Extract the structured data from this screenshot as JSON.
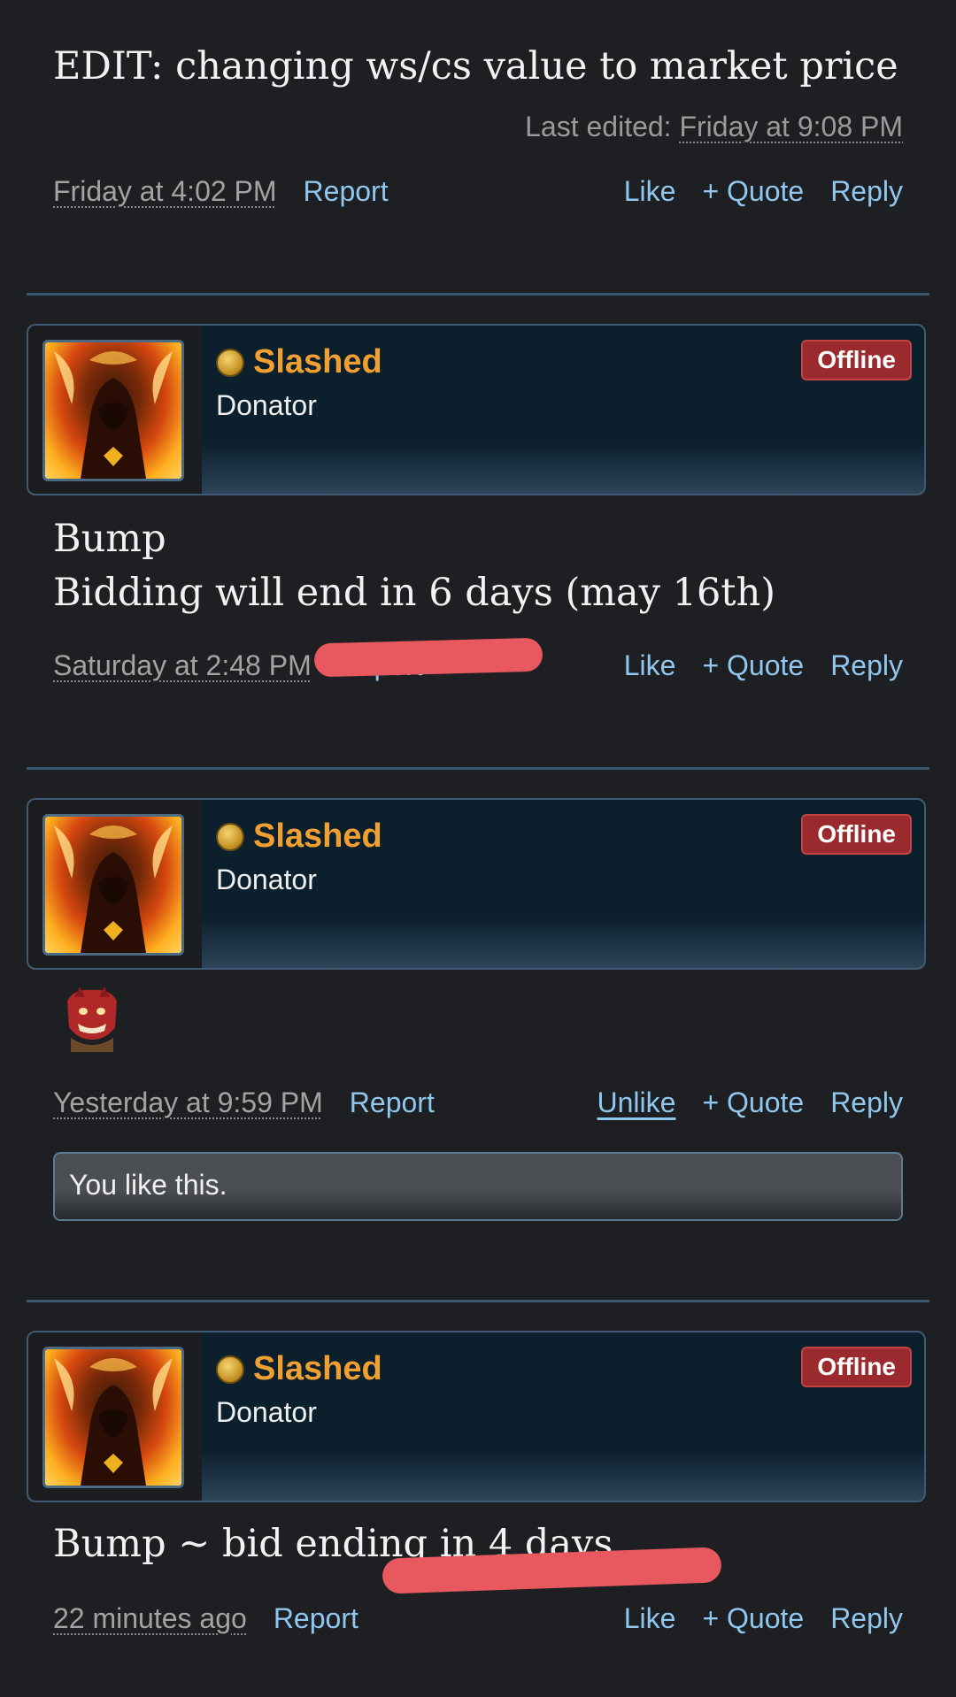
{
  "prev_post": {
    "text": "EDIT: changing ws/cs value to market price",
    "last_edited_label": "Last edited:",
    "last_edited_value": "Friday at 9:08 PM",
    "date": "Friday at 4:02 PM",
    "report": "Report",
    "like": "Like",
    "quote": "+ Quote",
    "reply": "Reply"
  },
  "posts": [
    {
      "username": "Slashed",
      "user_title": "Donator",
      "status": "Offline",
      "lines": [
        "Bump",
        "Bidding will end in 6 days (may 16th)"
      ],
      "date": "Saturday at 2:48 PM",
      "report": "Report",
      "like": "Like",
      "quote": "+ Quote",
      "reply": "Reply"
    },
    {
      "username": "Slashed",
      "user_title": "Donator",
      "status": "Offline",
      "date": "Yesterday at 9:59 PM",
      "report": "Report",
      "like": "Unlike",
      "quote": "+ Quote",
      "reply": "Reply",
      "like_notice": "You like this."
    },
    {
      "username": "Slashed",
      "user_title": "Donator",
      "status": "Offline",
      "lines": [
        "Bump ~ bid ending in 4 days"
      ],
      "date": "22 minutes ago",
      "report": "Report",
      "like": "Like",
      "quote": "+ Quote",
      "reply": "Reply"
    }
  ],
  "colors": {
    "background": "#1e1f22",
    "link": "#8fc7ee",
    "username": "#f0a030",
    "offline_badge": "#9b2a2e",
    "separator": "#3b5870",
    "redaction_mark": "#e8585f"
  },
  "icons": {
    "user_badge": "coin-icon",
    "avatar": "fire-demon-avatar",
    "sticker": "red-creature-sticker"
  }
}
